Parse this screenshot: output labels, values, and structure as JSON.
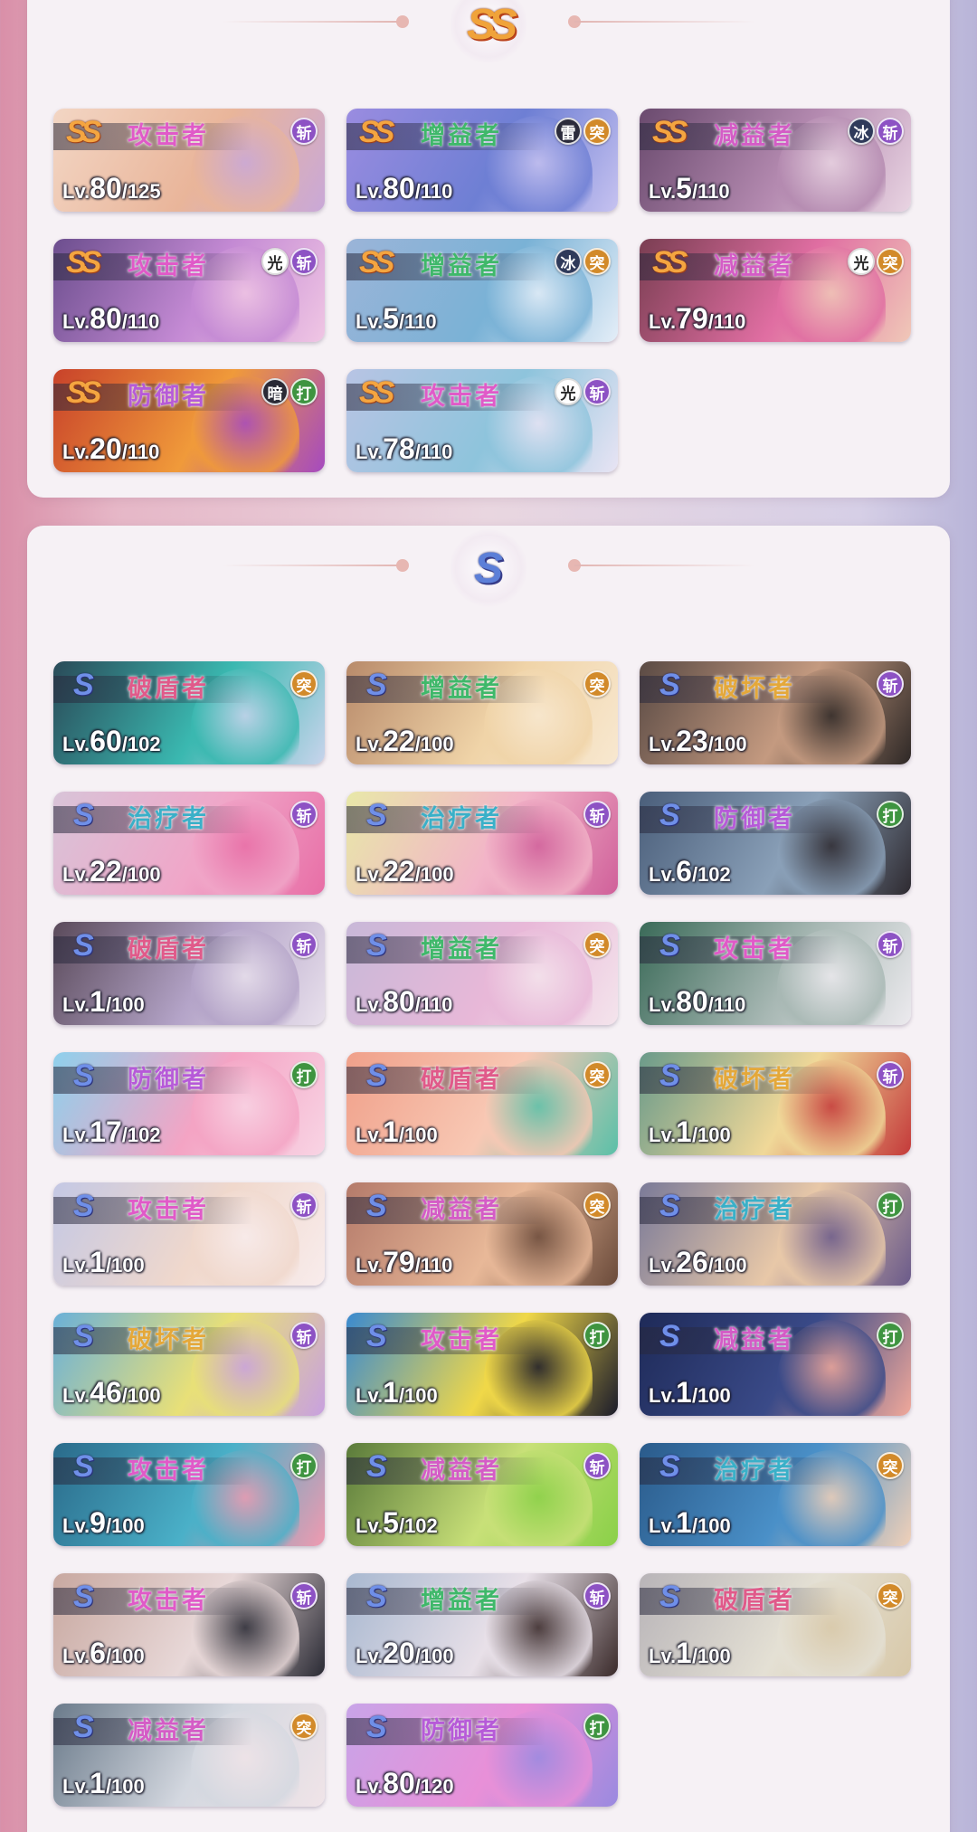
{
  "sections": [
    {
      "rank": "SS",
      "rank_label": "SS",
      "cards": [
        {
          "rank": "SS",
          "role": "攻击者",
          "lv_prefix": "Lv.",
          "level": "80",
          "max": "/125",
          "badges": [
            {
              "text": "斩",
              "type": "t-slash"
            }
          ],
          "colors": [
            "#f3d6c4",
            "#e9b59a",
            "#c9a8d8"
          ]
        },
        {
          "rank": "SS",
          "role": "增益者",
          "lv_prefix": "Lv.",
          "level": "80",
          "max": "/110",
          "badges": [
            {
              "text": "雷",
              "type": "e-thunder"
            },
            {
              "text": "突",
              "type": "t-pierce"
            }
          ],
          "colors": [
            "#9a8ce0",
            "#6e7fd4",
            "#c6c2f0"
          ]
        },
        {
          "rank": "SS",
          "role": "减益者",
          "lv_prefix": "Lv.",
          "level": "5",
          "max": "/110",
          "badges": [
            {
              "text": "冰",
              "type": "e-ice"
            },
            {
              "text": "斩",
              "type": "t-slash"
            }
          ],
          "colors": [
            "#6a4a6e",
            "#b48ab0",
            "#e9d4e2"
          ]
        },
        {
          "rank": "SS",
          "role": "攻击者",
          "lv_prefix": "Lv.",
          "level": "80",
          "max": "/110",
          "badges": [
            {
              "text": "光",
              "type": "e-light"
            },
            {
              "text": "斩",
              "type": "t-slash"
            }
          ],
          "colors": [
            "#6c4e8e",
            "#c48ad4",
            "#f0c6e4"
          ]
        },
        {
          "rank": "SS",
          "role": "增益者",
          "lv_prefix": "Lv.",
          "level": "5",
          "max": "/110",
          "badges": [
            {
              "text": "冰",
              "type": "e-ice"
            },
            {
              "text": "突",
              "type": "t-pierce"
            }
          ],
          "colors": [
            "#9bb4d8",
            "#7ab2d6",
            "#e4eef8"
          ]
        },
        {
          "rank": "SS",
          "role": "减益者",
          "lv_prefix": "Lv.",
          "level": "79",
          "max": "/110",
          "badges": [
            {
              "text": "光",
              "type": "e-light"
            },
            {
              "text": "突",
              "type": "t-pierce"
            }
          ],
          "colors": [
            "#7a3e52",
            "#e06ea2",
            "#f0c8b8"
          ]
        },
        {
          "rank": "SS",
          "role": "防御者",
          "lv_prefix": "Lv.",
          "level": "20",
          "max": "/110",
          "badges": [
            {
              "text": "暗",
              "type": "e-dark"
            },
            {
              "text": "打",
              "type": "t-strike"
            }
          ],
          "colors": [
            "#c8422a",
            "#f09a3a",
            "#a54ac0"
          ]
        },
        {
          "rank": "SS",
          "role": "攻击者",
          "lv_prefix": "Lv.",
          "level": "78",
          "max": "/110",
          "badges": [
            {
              "text": "光",
              "type": "e-light"
            },
            {
              "text": "斩",
              "type": "t-slash"
            }
          ],
          "colors": [
            "#b8c4e4",
            "#8ec4dc",
            "#e8e4f4"
          ]
        }
      ]
    },
    {
      "rank": "S",
      "rank_label": "S",
      "cards": [
        {
          "rank": "S",
          "role": "破盾者",
          "lv_prefix": "Lv.",
          "level": "60",
          "max": "/102",
          "badges": [
            {
              "text": "突",
              "type": "t-pierce"
            }
          ],
          "colors": [
            "#2a4a58",
            "#3ab8b0",
            "#c8d4ec"
          ]
        },
        {
          "rank": "S",
          "role": "增益者",
          "lv_prefix": "Lv.",
          "level": "22",
          "max": "/100",
          "badges": [
            {
              "text": "突",
              "type": "t-pierce"
            }
          ],
          "colors": [
            "#b88a6a",
            "#f0d4a8",
            "#f8e8d0"
          ]
        },
        {
          "rank": "S",
          "role": "破坏者",
          "lv_prefix": "Lv.",
          "level": "23",
          "max": "/100",
          "badges": [
            {
              "text": "斩",
              "type": "t-slash"
            }
          ],
          "colors": [
            "#5a4a44",
            "#c49a80",
            "#2e2826"
          ]
        },
        {
          "rank": "S",
          "role": "治疗者",
          "lv_prefix": "Lv.",
          "level": "22",
          "max": "/100",
          "badges": [
            {
              "text": "斩",
              "type": "t-slash"
            }
          ],
          "colors": [
            "#d8c4d8",
            "#f0a6c8",
            "#e86ea6"
          ]
        },
        {
          "rank": "S",
          "role": "治疗者",
          "lv_prefix": "Lv.",
          "level": "22",
          "max": "/100",
          "badges": [
            {
              "text": "斩",
              "type": "t-slash"
            }
          ],
          "colors": [
            "#e8e8a8",
            "#f2b4c8",
            "#d0609a"
          ]
        },
        {
          "rank": "S",
          "role": "防御者",
          "lv_prefix": "Lv.",
          "level": "6",
          "max": "/102",
          "badges": [
            {
              "text": "打",
              "type": "t-strike"
            }
          ],
          "colors": [
            "#4a5e7a",
            "#8aa0b8",
            "#2e2a30"
          ]
        },
        {
          "rank": "S",
          "role": "破盾者",
          "lv_prefix": "Lv.",
          "level": "1",
          "max": "/100",
          "badges": [
            {
              "text": "斩",
              "type": "t-slash"
            }
          ],
          "colors": [
            "#5a4a5a",
            "#b4a4c8",
            "#e8e0ec"
          ]
        },
        {
          "rank": "S",
          "role": "增益者",
          "lv_prefix": "Lv.",
          "level": "80",
          "max": "/110",
          "badges": [
            {
              "text": "突",
              "type": "t-pierce"
            }
          ],
          "colors": [
            "#c8b8d8",
            "#e8b8d8",
            "#f4e4ec"
          ]
        },
        {
          "rank": "S",
          "role": "攻击者",
          "lv_prefix": "Lv.",
          "level": "80",
          "max": "/110",
          "badges": [
            {
              "text": "斩",
              "type": "t-slash"
            }
          ],
          "colors": [
            "#3a6a58",
            "#a8b8b4",
            "#eceaee"
          ]
        },
        {
          "rank": "S",
          "role": "防御者",
          "lv_prefix": "Lv.",
          "level": "17",
          "max": "/102",
          "badges": [
            {
              "text": "打",
              "type": "t-strike"
            }
          ],
          "colors": [
            "#8ed0ec",
            "#f4a4c4",
            "#f8d4e4"
          ]
        },
        {
          "rank": "S",
          "role": "破盾者",
          "lv_prefix": "Lv.",
          "level": "1",
          "max": "/100",
          "badges": [
            {
              "text": "突",
              "type": "t-pierce"
            }
          ],
          "colors": [
            "#f0a08a",
            "#f8c8b4",
            "#5ac0a8"
          ]
        },
        {
          "rank": "S",
          "role": "破坏者",
          "lv_prefix": "Lv.",
          "level": "1",
          "max": "/100",
          "badges": [
            {
              "text": "斩",
              "type": "t-slash"
            }
          ],
          "colors": [
            "#6a9a8a",
            "#f0d898",
            "#c43a3a"
          ]
        },
        {
          "rank": "S",
          "role": "攻击者",
          "lv_prefix": "Lv.",
          "level": "1",
          "max": "/100",
          "badges": [
            {
              "text": "斩",
              "type": "t-slash"
            }
          ],
          "colors": [
            "#c4c8e4",
            "#f0d8cc",
            "#f8ecec"
          ]
        },
        {
          "rank": "S",
          "role": "减益者",
          "lv_prefix": "Lv.",
          "level": "79",
          "max": "/110",
          "badges": [
            {
              "text": "突",
              "type": "t-pierce"
            }
          ],
          "colors": [
            "#b47a6a",
            "#e8b898",
            "#6a4a3a"
          ]
        },
        {
          "rank": "S",
          "role": "治疗者",
          "lv_prefix": "Lv.",
          "level": "26",
          "max": "/100",
          "badges": [
            {
              "text": "打",
              "type": "t-strike"
            }
          ],
          "colors": [
            "#7a7a98",
            "#e8c8a8",
            "#6a5a8a"
          ]
        },
        {
          "rank": "S",
          "role": "破坏者",
          "lv_prefix": "Lv.",
          "level": "46",
          "max": "/100",
          "badges": [
            {
              "text": "斩",
              "type": "t-slash"
            }
          ],
          "colors": [
            "#6ab0d8",
            "#e8e078",
            "#c8a0e0"
          ]
        },
        {
          "rank": "S",
          "role": "攻击者",
          "lv_prefix": "Lv.",
          "level": "1",
          "max": "/100",
          "badges": [
            {
              "text": "打",
              "type": "t-strike"
            }
          ],
          "colors": [
            "#3a8ad0",
            "#f0d848",
            "#1a1a2a"
          ]
        },
        {
          "rank": "S",
          "role": "减益者",
          "lv_prefix": "Lv.",
          "level": "1",
          "max": "/100",
          "badges": [
            {
              "text": "打",
              "type": "t-strike"
            }
          ],
          "colors": [
            "#1e2a58",
            "#3a4a88",
            "#f0a89a"
          ]
        },
        {
          "rank": "S",
          "role": "攻击者",
          "lv_prefix": "Lv.",
          "level": "9",
          "max": "/100",
          "badges": [
            {
              "text": "打",
              "type": "t-strike"
            }
          ],
          "colors": [
            "#2a6a8a",
            "#4ab0c8",
            "#f09ab0"
          ]
        },
        {
          "rank": "S",
          "role": "减益者",
          "lv_prefix": "Lv.",
          "level": "5",
          "max": "/102",
          "badges": [
            {
              "text": "斩",
              "type": "t-slash"
            }
          ],
          "colors": [
            "#5a7a3a",
            "#c8e078",
            "#8ad048"
          ]
        },
        {
          "rank": "S",
          "role": "治疗者",
          "lv_prefix": "Lv.",
          "level": "1",
          "max": "/100",
          "badges": [
            {
              "text": "突",
              "type": "t-pierce"
            }
          ],
          "colors": [
            "#2a5a8a",
            "#4a90c8",
            "#f0d0b8"
          ]
        },
        {
          "rank": "S",
          "role": "攻击者",
          "lv_prefix": "Lv.",
          "level": "6",
          "max": "/100",
          "badges": [
            {
              "text": "斩",
              "type": "t-slash"
            }
          ],
          "colors": [
            "#c8a8a0",
            "#e8d8d8",
            "#2a2a34"
          ]
        },
        {
          "rank": "S",
          "role": "增益者",
          "lv_prefix": "Lv.",
          "level": "20",
          "max": "/100",
          "badges": [
            {
              "text": "斩",
              "type": "t-slash"
            }
          ],
          "colors": [
            "#a8b8d0",
            "#e8e0e8",
            "#3a2a2a"
          ]
        },
        {
          "rank": "S",
          "role": "破盾者",
          "lv_prefix": "Lv.",
          "level": "1",
          "max": "/100",
          "badges": [
            {
              "text": "突",
              "type": "t-pierce"
            }
          ],
          "colors": [
            "#b8b4b8",
            "#e4e0d4",
            "#d8c8a8"
          ]
        },
        {
          "rank": "S",
          "role": "减益者",
          "lv_prefix": "Lv.",
          "level": "1",
          "max": "/100",
          "badges": [
            {
              "text": "突",
              "type": "t-pierce"
            }
          ],
          "colors": [
            "#6a7a8a",
            "#d4d8e0",
            "#f0e4e8"
          ]
        },
        {
          "rank": "S",
          "role": "防御者",
          "lv_prefix": "Lv.",
          "level": "80",
          "max": "/120",
          "badges": [
            {
              "text": "打",
              "type": "t-strike"
            }
          ],
          "colors": [
            "#c8a4e8",
            "#e890d8",
            "#9a8ae0"
          ]
        }
      ]
    }
  ]
}
